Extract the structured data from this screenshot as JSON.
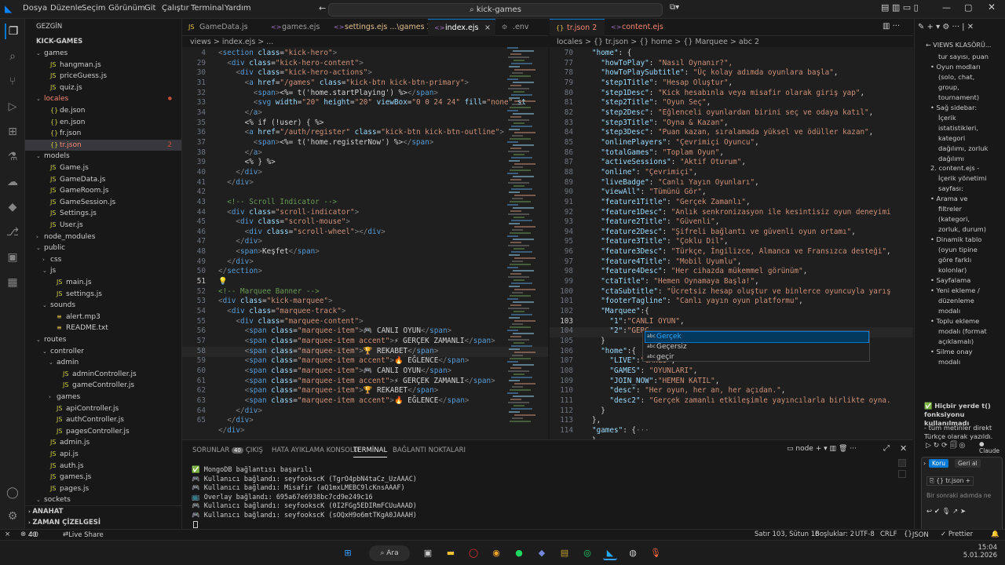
{
  "titlebar": {
    "menus": [
      "Dosya",
      "Düzenle",
      "Seçim",
      "Görünüm",
      "Git",
      "Çalıştır",
      "Terminal",
      "Yardım"
    ],
    "search": "kick-games"
  },
  "sidebar": {
    "title": "GEZGİN",
    "root": "KICK-GAMES",
    "items": [
      {
        "label": "games",
        "type": "folder",
        "depth": 1,
        "open": true
      },
      {
        "label": "hangman.js",
        "type": "js",
        "depth": 2
      },
      {
        "label": "priceGuess.js",
        "type": "js",
        "depth": 2
      },
      {
        "label": "quiz.js",
        "type": "js",
        "depth": 2
      },
      {
        "label": "locales",
        "type": "folder",
        "depth": 1,
        "open": true,
        "modified": true
      },
      {
        "label": "de.json",
        "type": "json",
        "depth": 2
      },
      {
        "label": "en.json",
        "type": "json",
        "depth": 2
      },
      {
        "label": "fr.json",
        "type": "json",
        "depth": 2
      },
      {
        "label": "tr.json",
        "type": "json",
        "depth": 2,
        "selected": true,
        "badge": "2"
      },
      {
        "label": "models",
        "type": "folder",
        "depth": 1,
        "open": true
      },
      {
        "label": "Game.js",
        "type": "js",
        "depth": 2
      },
      {
        "label": "GameData.js",
        "type": "js",
        "depth": 2
      },
      {
        "label": "GameRoom.js",
        "type": "js",
        "depth": 2
      },
      {
        "label": "GameSession.js",
        "type": "js",
        "depth": 2
      },
      {
        "label": "Settings.js",
        "type": "js",
        "depth": 2
      },
      {
        "label": "User.js",
        "type": "js",
        "depth": 2
      },
      {
        "label": "node_modules",
        "type": "folder",
        "depth": 1,
        "open": false
      },
      {
        "label": "public",
        "type": "folder",
        "depth": 1,
        "open": true
      },
      {
        "label": "css",
        "type": "folder",
        "depth": 2,
        "open": false
      },
      {
        "label": "js",
        "type": "folder",
        "depth": 2,
        "open": true
      },
      {
        "label": "main.js",
        "type": "js",
        "depth": 3
      },
      {
        "label": "settings.js",
        "type": "js",
        "depth": 3
      },
      {
        "label": "sounds",
        "type": "folder",
        "depth": 2,
        "open": true
      },
      {
        "label": "alert.mp3",
        "type": "file",
        "depth": 3
      },
      {
        "label": "README.txt",
        "type": "file",
        "depth": 3
      },
      {
        "label": "routes",
        "type": "folder",
        "depth": 1,
        "open": true
      },
      {
        "label": "controller",
        "type": "folder",
        "depth": 2,
        "open": true
      },
      {
        "label": "admin",
        "type": "folder",
        "depth": 3,
        "open": true
      },
      {
        "label": "adminController.js",
        "type": "js",
        "depth": 4
      },
      {
        "label": "gameController.js",
        "type": "js",
        "depth": 4
      },
      {
        "label": "games",
        "type": "folder",
        "depth": 3,
        "open": false
      },
      {
        "label": "apiController.js",
        "type": "js",
        "depth": 3
      },
      {
        "label": "authController.js",
        "type": "js",
        "depth": 3
      },
      {
        "label": "pagesController.js",
        "type": "js",
        "depth": 3
      },
      {
        "label": "admin.js",
        "type": "js",
        "depth": 2
      },
      {
        "label": "api.js",
        "type": "js",
        "depth": 2
      },
      {
        "label": "auth.js",
        "type": "js",
        "depth": 2
      },
      {
        "label": "games.js",
        "type": "js",
        "depth": 2
      },
      {
        "label": "pages.js",
        "type": "js",
        "depth": 2
      },
      {
        "label": "sockets",
        "type": "folder",
        "depth": 1,
        "open": true
      }
    ],
    "outline": "ANAHAT",
    "timeline": "ZAMAN ÇİZELGESİ"
  },
  "editor1": {
    "tabs": [
      {
        "label": "GameData.js"
      },
      {
        "label": "games.ejs"
      },
      {
        "label": "settings.ejs ...\\games 3",
        "active": false
      },
      {
        "label": "index.ejs",
        "active": true
      },
      {
        "label": ".env"
      }
    ],
    "breadcrumb": "views > index.ejs > ...",
    "lines": [
      4,
      29,
      30,
      31,
      32,
      33,
      34,
      35,
      36,
      37,
      38,
      39,
      40,
      41,
      42,
      43,
      44,
      45,
      46,
      47,
      48,
      49,
      50,
      51,
      52,
      53,
      54,
      55,
      56,
      57,
      58,
      59,
      60,
      61,
      62,
      63,
      64,
      65
    ]
  },
  "editor2": {
    "tabs": [
      {
        "label": "tr.json 2",
        "active": true
      },
      {
        "label": "content.ejs"
      }
    ],
    "breadcrumb": "locales > {} tr.json > {} home > {} Marquee > abc 2",
    "lines": [
      70,
      77,
      78,
      79,
      80,
      81,
      82,
      83,
      84,
      85,
      86,
      87,
      88,
      89,
      90,
      91,
      92,
      93,
      94,
      95,
      96,
      97,
      98,
      99,
      100,
      101,
      102,
      103,
      104,
      105,
      106,
      107,
      108,
      109,
      110,
      111,
      112,
      113,
      114
    ],
    "suggestions": [
      "Gerçek",
      "Geçersiz",
      "geçir"
    ]
  },
  "panel": {
    "tabs": [
      "SORUNLAR",
      "ÇIKIŞ",
      "HATA AYIKLAMA KONSOLU",
      "TERMİNAL",
      "BAĞLANTI NOKTALARI"
    ],
    "problems_count": "40",
    "terminal_name": "node",
    "terminal": [
      "✅ MongoDB bağlantısı başarılı",
      "🎮 Kullanıcı bağlandı: seyfookscK (TgrO4pbN4taCz_UzAAAC)",
      "🎮 Kullanıcı bağlandı: Misafir (aQ1mxLMEBC9lcKnsAAAF)",
      "📺 Overlay bağlandı: 695a67e6938bc7cd9e249c16",
      "🎮 Kullanıcı bağlandı: seyfookscK (0I2FGg5EDIRmFCUuAAAD)",
      "🎮 Kullanıcı bağlandı: seyfookscK (sOQxH9o6mtTKgA0JAAAH)"
    ]
  },
  "chat": {
    "header": "VIEWS KLASÖRÜ...",
    "lines": [
      "tur sayısı, puan",
      "• Oyun modları",
      "(solo, chat,",
      "group,",
      "tournament)",
      "• Sağ sidebar:",
      "İçerik",
      "istatistikleri,",
      "kategori",
      "dağılımı, zorluk",
      "dağılımı",
      "2. content.ejs -",
      "İçerik yönetimi",
      "sayfası:",
      "• Arama ve",
      "filtreler",
      "(kategori,",
      "zorluk, durum)",
      "• Dinamik tablo",
      "(oyun tipine",
      "göre farklı",
      "kolonlar)",
      "• Sayfalama",
      "• Yeni ekleme /",
      "düzenleme",
      "modalı",
      "• Toplu ekleme",
      "modalı (format",
      "açıklamalı)",
      "• Silme onay",
      "modalı"
    ],
    "note_title": "✅ Hiçbir yerde t() fonksiyonu kullanılmadı",
    "note_body": "- tüm metinler direkt Türkçe olarak yazıldı.",
    "keep": "Koru",
    "undo": "Geri al",
    "file": "tr.json",
    "placeholder": "Bir sonraki adımda ne",
    "model": "Claude"
  },
  "status": {
    "errors": "40",
    "warnings": "0",
    "liveshare": "Live Share",
    "position": "Satır 103, Sütun 16",
    "spaces": "Boşluklar: 2",
    "encoding": "UTF-8",
    "eol": "CRLF",
    "lang": "JSON",
    "prettier": "✓ Prettier"
  },
  "taskbar": {
    "search": "Ara",
    "time": "15:04",
    "date": "5.01.2026"
  }
}
